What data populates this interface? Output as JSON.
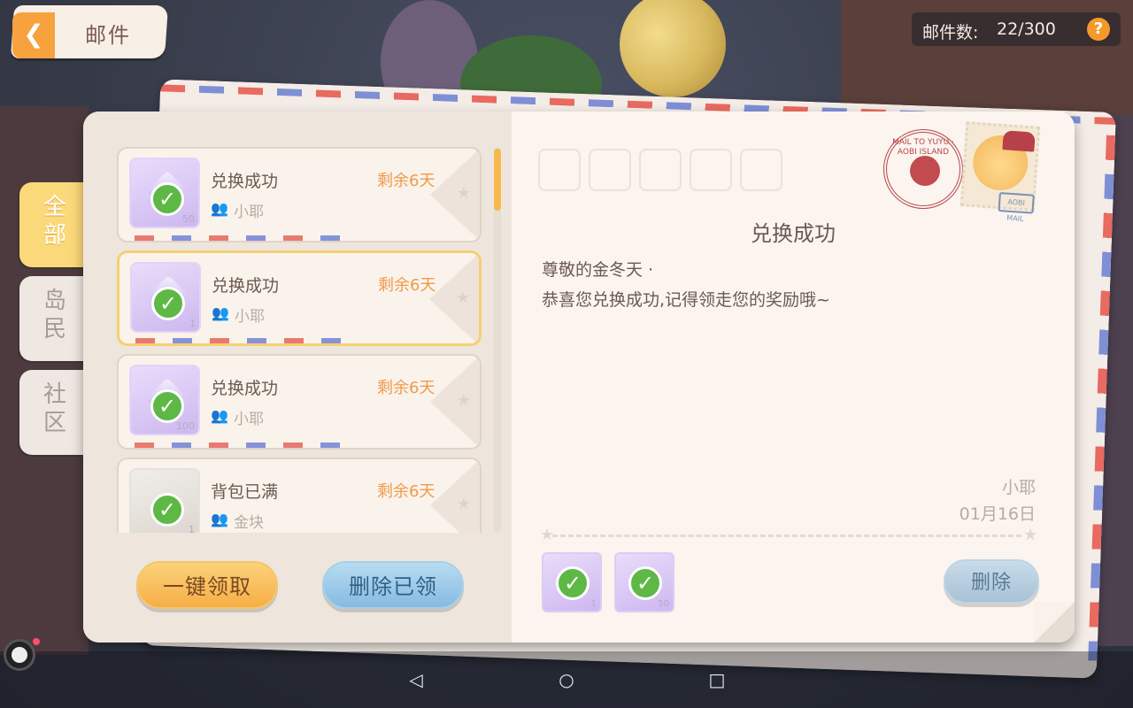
{
  "header": {
    "title": "邮件",
    "mail_count_label": "邮件数:",
    "mail_count_value": "22/300",
    "help_icon": "?"
  },
  "categories": [
    {
      "label": "全部",
      "active": true
    },
    {
      "label": "岛民",
      "active": false
    },
    {
      "label": "社区",
      "active": false
    }
  ],
  "mail_list": [
    {
      "title": "兑换成功",
      "sender": "小耶",
      "remain": "剩余6天",
      "icon": "crystal-reward-icon",
      "qty": "50",
      "selected": false
    },
    {
      "title": "兑换成功",
      "sender": "小耶",
      "remain": "剩余6天",
      "icon": "scroll-reward-icon",
      "qty": "1",
      "selected": true
    },
    {
      "title": "兑换成功",
      "sender": "小耶",
      "remain": "剩余6天",
      "icon": "crystal-reward-icon",
      "qty": "100",
      "selected": false
    },
    {
      "title": "背包已满",
      "sender": "金块",
      "remain": "剩余6天",
      "icon": "gold-bar-icon",
      "qty": "1",
      "selected": false
    }
  ],
  "buttons": {
    "claim_all": "一键领取",
    "delete_read": "删除已领",
    "delete": "删除"
  },
  "detail": {
    "title": "兑换成功",
    "greeting": "尊敬的金冬天 ·",
    "body": "恭喜您兑换成功,记得领走您的奖励哦~",
    "sender": "小耶",
    "date": "01月16日",
    "rewards": [
      {
        "icon": "scroll-reward-icon",
        "qty": "1"
      },
      {
        "icon": "crystal-reward-icon",
        "qty": "50"
      }
    ]
  },
  "stamp": {
    "seal_text": "MAIL TO YUYU · AOBI ISLAND",
    "postmark_text": "AOBI MAIL"
  },
  "colors": {
    "accent_orange": "#f7a23e",
    "remain_orange": "#ef9a4a",
    "active_tab": "#fbd97a",
    "check_green": "#5db845",
    "reward_purple": "#cdb8ef"
  }
}
